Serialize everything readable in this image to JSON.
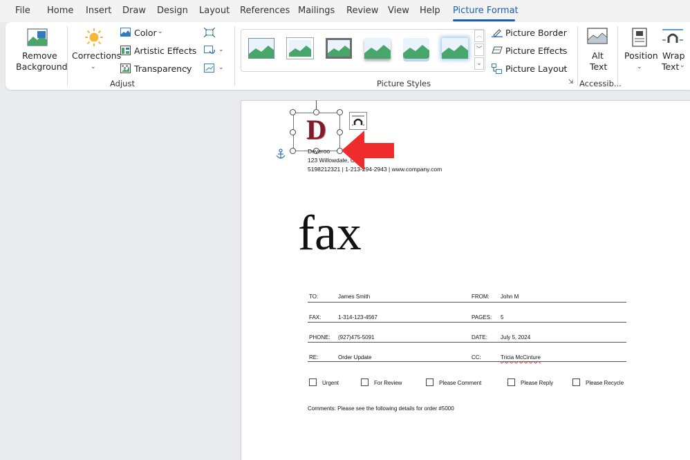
{
  "menu": {
    "tabs": [
      "File",
      "Home",
      "Insert",
      "Draw",
      "Design",
      "Layout",
      "References",
      "Mailings",
      "Review",
      "View",
      "Help",
      "Picture Format"
    ],
    "active": "Picture Format",
    "accent": "#1a5fb4"
  },
  "ribbon": {
    "remove_background": [
      "Remove",
      "Background"
    ],
    "corrections": "Corrections",
    "color": "Color",
    "artistic_effects": "Artistic Effects",
    "transparency": "Transparency",
    "adjust_label": "Adjust",
    "picture_styles_label": "Picture Styles",
    "picture_border": "Picture Border",
    "picture_effects": "Picture Effects",
    "picture_layout": "Picture Layout",
    "alt_text": [
      "Alt",
      "Text"
    ],
    "accessibility_label": "Accessib...",
    "position": "Position",
    "wrap_text": [
      "Wrap",
      "Text"
    ]
  },
  "document": {
    "logo_letter": "D",
    "company_name": "Deveroo",
    "address": "123 Willowdale, CA",
    "contact": "5198212321 | 1-213-294-2943 | www.company.com",
    "title": "fax",
    "fields": [
      {
        "label": "TO:",
        "value": "James Smith",
        "label2": "FROM:",
        "value2": "John M"
      },
      {
        "label": "FAX:",
        "value": "1-314-123-4567",
        "label2": "PAGES:",
        "value2": "5"
      },
      {
        "label": "PHONE:",
        "value": "(927)475-5091",
        "label2": "DATE:",
        "value2": "July 5, 2024"
      },
      {
        "label": "RE:",
        "value": "Order Update",
        "label2": "CC:",
        "value2": "Tricia McCinture"
      }
    ],
    "checkboxes": [
      "Urgent",
      "For Review",
      "Please Comment",
      "Please Reply",
      "Please Recycle"
    ],
    "comments": "Comments:  Please see the following details for order #5000"
  }
}
